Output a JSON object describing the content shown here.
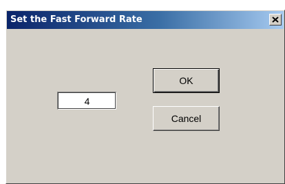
{
  "window": {
    "title": "Set the Fast Forward Rate"
  },
  "rate": {
    "value": "4"
  },
  "buttons": {
    "ok_label": "OK",
    "cancel_label": "Cancel"
  },
  "icons": {
    "close": "close-icon"
  },
  "colors": {
    "titlebar_start": "#0a246a",
    "titlebar_end": "#a6caf0",
    "dialog_face": "#d4d0c8"
  }
}
